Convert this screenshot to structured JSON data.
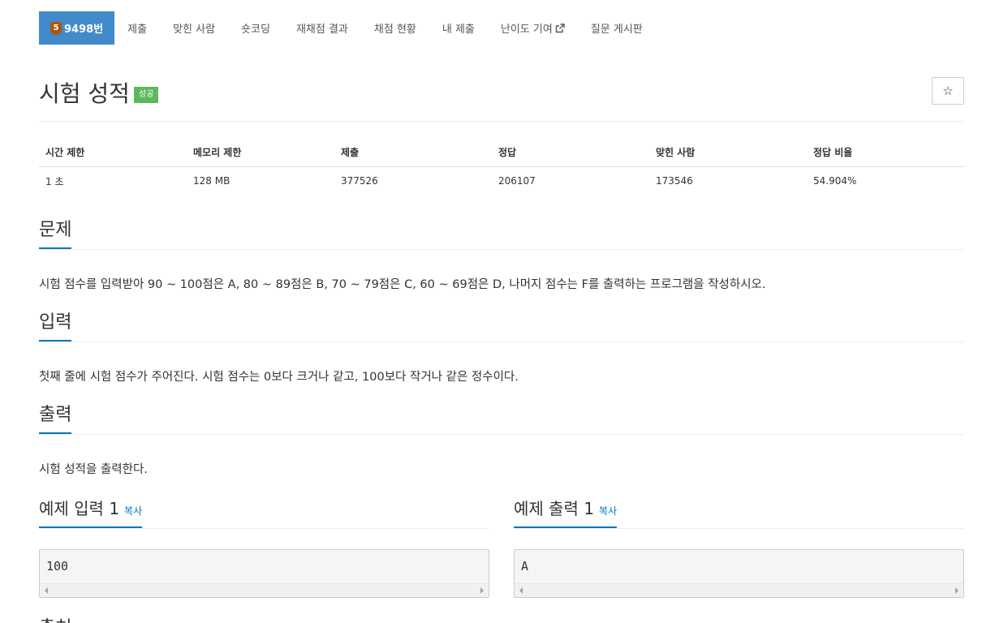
{
  "nav": {
    "problem_tab": {
      "tier_badge": "5",
      "label": "9498번",
      "tier_color": "#ad5600"
    },
    "items": [
      {
        "label": "제출"
      },
      {
        "label": "맞힌 사람"
      },
      {
        "label": "숏코딩"
      },
      {
        "label": "재채점 결과"
      },
      {
        "label": "채점 현황"
      },
      {
        "label": "내 제출"
      },
      {
        "label": "난이도 기여",
        "icon": "external-link-icon"
      },
      {
        "label": "질문 게시판"
      }
    ],
    "accent_color": "#428bca"
  },
  "title": {
    "text": "시험 성적",
    "status_label": "성공",
    "status_color": "#5cb85c",
    "star_icon": "☆"
  },
  "info_table": {
    "headers": [
      "시간 제한",
      "메모리 제한",
      "제출",
      "정답",
      "맞힌 사람",
      "정답 비율"
    ],
    "values": [
      "1 초",
      "128 MB",
      "377526",
      "206107",
      "173546",
      "54.904%"
    ]
  },
  "sections": {
    "problem": {
      "heading": "문제",
      "text": "시험 점수를 입력받아 90 ~ 100점은 A, 80 ~ 89점은 B, 70 ~ 79점은 C, 60 ~ 69점은 D, 나머지 점수는 F를 출력하는 프로그램을 작성하시오."
    },
    "input": {
      "heading": "입력",
      "text": "첫째 줄에 시험 점수가 주어진다. 시험 점수는 0보다 크거나 같고, 100보다 작거나 같은 정수이다."
    },
    "output": {
      "heading": "출력",
      "text": "시험 성적을 출력한다."
    }
  },
  "samples": {
    "input": {
      "heading": "예제 입력 1",
      "copy_label": "복사",
      "content": "100"
    },
    "output": {
      "heading": "예제 출력 1",
      "copy_label": "복사",
      "content": "A"
    }
  },
  "next_heading_partial": "출처",
  "link_color": "#0076c0"
}
